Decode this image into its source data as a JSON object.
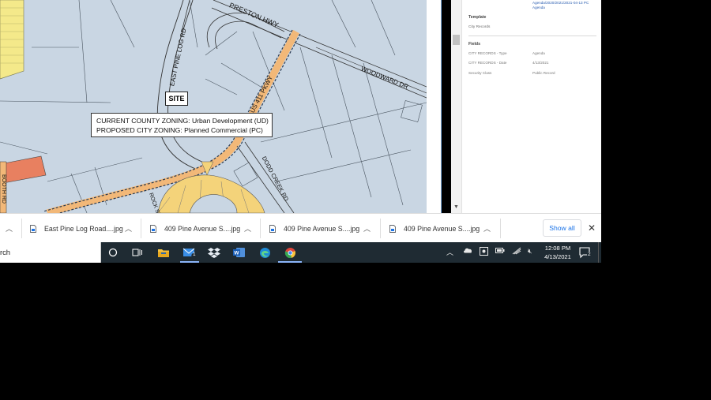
{
  "map": {
    "road_labels": {
      "preston_hwy": "PRESTON HWY",
      "east_pine_log_rd": "EAST PINE LOG RD",
      "woodward_dr": "WOODWARD DR",
      "boulevard": "US 411 PKWY",
      "dodd_creek_rd": "DODD CREEK RD",
      "bottom_left": "BOOTH RD",
      "rock_st": "ROCK ST"
    },
    "site_label": "SITE",
    "zoning": {
      "current": "CURRENT COUNTY ZONING: Urban Development (UD)",
      "proposed": "PROPOSED CITY ZONING: Planned Commercial (PC)"
    }
  },
  "panel": {
    "link_line1": "Agenda/2020/2021/2021-04-13 PC",
    "link_line2": "Agenda",
    "template_heading": "Template",
    "template_value": "City Records",
    "fields_heading": "Fields",
    "fields": [
      {
        "key": "CITY RECORDS - Type",
        "value": "Agenda"
      },
      {
        "key": "CITY RECORDS - Date",
        "value": "4/13/2021"
      },
      {
        "key": "Security Class",
        "value": "Public Record"
      }
    ]
  },
  "downloads": {
    "items": [
      {
        "label": "East Pine Log Road....jpg"
      },
      {
        "label": "409 Pine Avenue S....jpg"
      },
      {
        "label": "409 Pine Avenue S....jpg"
      },
      {
        "label": "409 Pine Avenue S....jpg"
      }
    ],
    "show_all_label": "Show all",
    "close_label": "✕"
  },
  "taskbar": {
    "search_text": "rch",
    "mail_badge": "1",
    "time": "12:08 PM",
    "date": "4/13/2021",
    "notification_count": "2"
  },
  "colors": {
    "map_bg": "#c9d6e3",
    "road_orange": "#f2b878",
    "zone_yellow": "#f4e98a",
    "chrome_blue": "#1a73e8",
    "taskbar_bg": "#1f2b33"
  }
}
